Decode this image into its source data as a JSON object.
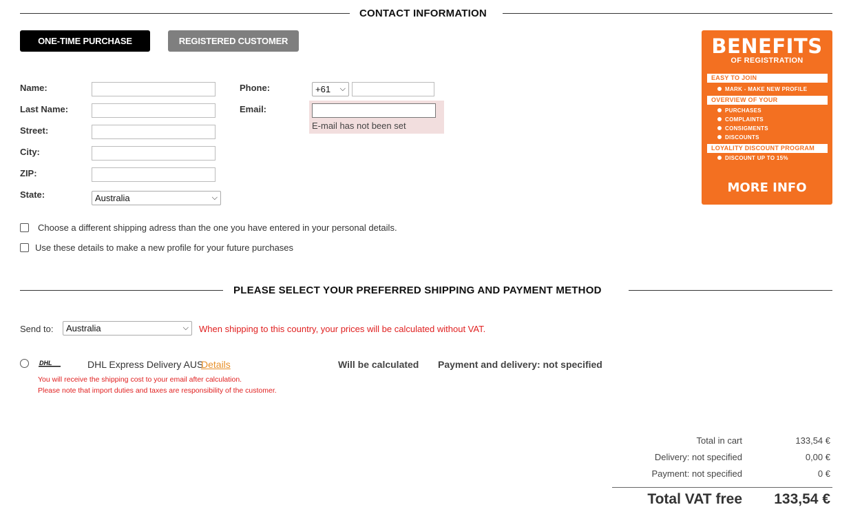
{
  "contact_section": {
    "title": "CONTACT INFORMATION"
  },
  "tabs": {
    "one_time": "ONE-TIME PURCHASE",
    "registered": "REGISTERED CUSTOMER"
  },
  "form": {
    "name_label": "Name:",
    "last_name_label": "Last Name:",
    "street_label": "Street:",
    "city_label": "City:",
    "zip_label": "ZIP:",
    "state_label": "State:",
    "state_value": "Australia",
    "phone_label": "Phone:",
    "phone_prefix": "+61",
    "email_label": "Email:",
    "email_error": "E-mail has not been set"
  },
  "benefits": {
    "title": "BENEFITS",
    "subtitle": "OF REGISTRATION",
    "easy_to_join": "EASY TO JOIN",
    "mark_item": "MARK - MAKE NEW PROFILE",
    "overview": "OVERVIEW OF YOUR",
    "overview_items": [
      "PURCHASES",
      "COMPLAINTS",
      "CONSIGMENTS",
      "DISCOUNTS"
    ],
    "loyality": "LOYALITY DISCOUNT PROGRAM",
    "discount_item": "DISCOUNT UP TO 15%",
    "more_info": "MORE INFO",
    "color": "#f37021"
  },
  "checkboxes": {
    "different_shipping": "Choose a different shipping adress than the one you have entered in your personal details.",
    "new_profile": "Use these details to make a new profile for your future purchases"
  },
  "shipping_section": {
    "title": "PLEASE SELECT YOUR PREFERRED SHIPPING AND PAYMENT METHOD"
  },
  "shipping": {
    "send_to_label": "Send to:",
    "send_to_value": "Australia",
    "vat_note": "When shipping to this country, your prices will be calculated without VAT.",
    "method_name": "DHL Express Delivery AUS",
    "details_link": "Details",
    "price_status": "Will be calculated",
    "payment_delivery": "Payment and delivery: not specified",
    "note1": "You will receive the shipping cost to your email after calculation.",
    "note2": "Please note that import duties and taxes are responsibility of the customer.",
    "note_color": "#e02020"
  },
  "summary": {
    "total_in_cart_label": "Total in cart",
    "total_in_cart_value": "133,54 €",
    "delivery_label": "Delivery: not specified",
    "delivery_value": "0,00 €",
    "payment_label": "Payment: not specified",
    "payment_value": "0 €",
    "total_label": "Total VAT free",
    "total_value": "133,54 €"
  }
}
